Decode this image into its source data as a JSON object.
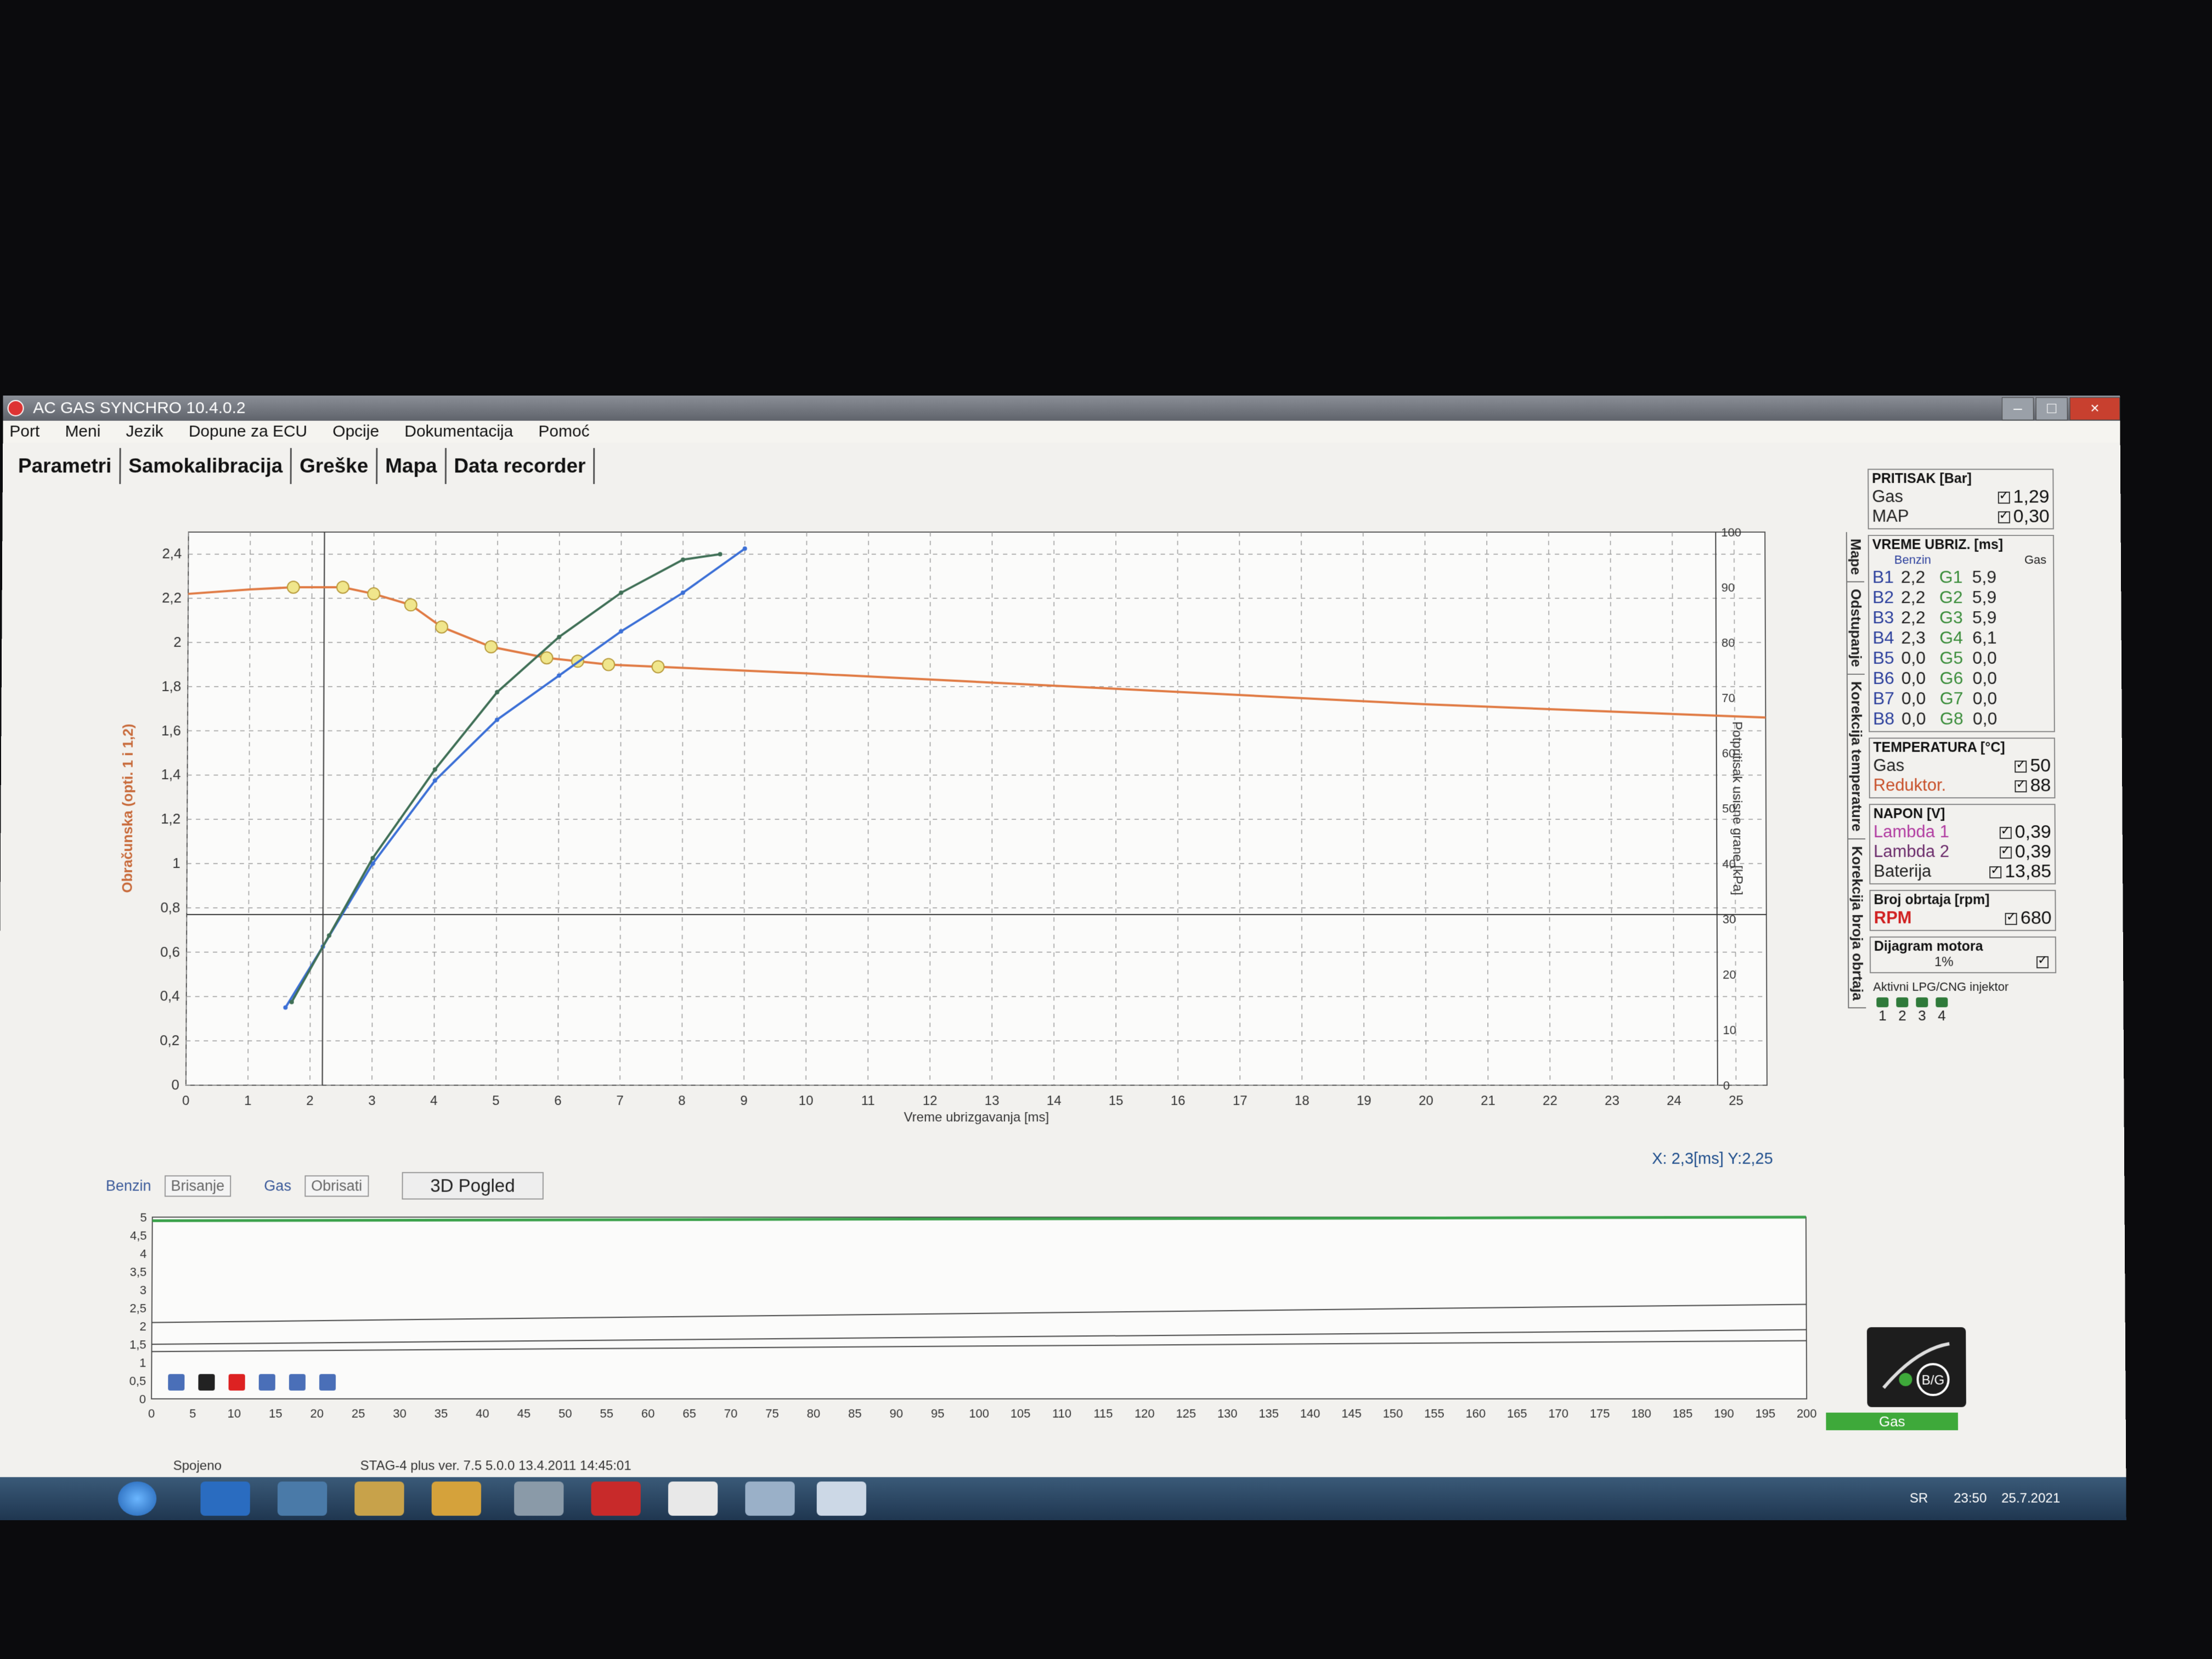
{
  "window": {
    "title": "AC GAS SYNCHRO  10.4.0.2",
    "controls": [
      "–",
      "□",
      "×"
    ]
  },
  "menu": [
    "Port",
    "Meni",
    "Jezik",
    "Dopune za ECU",
    "Opcije",
    "Dokumentacija",
    "Pomoć"
  ],
  "tabs": [
    "Parametri",
    "Samokalibracija",
    "Greške",
    "Mapa",
    "Data recorder"
  ],
  "cursor_readout": "X:  2,3[ms] Y:2,25",
  "bottom_toolbar": {
    "benzin_label": "Benzin",
    "brisanje": "Brisanje",
    "gas_label": "Gas",
    "obrisati": "Obrisati",
    "pogled": "3D Pogled"
  },
  "side_tabs": [
    "Mape",
    "Odstupanje",
    "Korekcija temperature",
    "Korekcija broja obrtaja"
  ],
  "pritisak": {
    "title": "PRITISAK [Bar]",
    "gas_label": "Gas",
    "gas_value": "1,29",
    "map_label": "MAP",
    "map_value": "0,30"
  },
  "vreme": {
    "title": "VREME UBRIZ. [ms]",
    "benzin_head": "Benzin",
    "gas_head": "Gas",
    "rows": [
      {
        "b": "B1",
        "bv": "2,2",
        "g": "G1",
        "gv": "5,9"
      },
      {
        "b": "B2",
        "bv": "2,2",
        "g": "G2",
        "gv": "5,9"
      },
      {
        "b": "B3",
        "bv": "2,2",
        "g": "G3",
        "gv": "5,9"
      },
      {
        "b": "B4",
        "bv": "2,3",
        "g": "G4",
        "gv": "6,1"
      },
      {
        "b": "B5",
        "bv": "0,0",
        "g": "G5",
        "gv": "0,0"
      },
      {
        "b": "B6",
        "bv": "0,0",
        "g": "G6",
        "gv": "0,0"
      },
      {
        "b": "B7",
        "bv": "0,0",
        "g": "G7",
        "gv": "0,0"
      },
      {
        "b": "B8",
        "bv": "0,0",
        "g": "G8",
        "gv": "0,0"
      }
    ]
  },
  "temperatura": {
    "title": "TEMPERATURA [°C]",
    "gas_label": "Gas",
    "gas_value": "50",
    "red_label": "Reduktor.",
    "red_value": "88"
  },
  "napon": {
    "title": "NAPON [V]",
    "l1_label": "Lambda 1",
    "l1_value": "0,39",
    "l2_label": "Lambda 2",
    "l2_value": "0,39",
    "bat_label": "Baterija",
    "bat_value": "13,85"
  },
  "obrtaji": {
    "title": "Broj obrtaja [rpm]",
    "rpm_label": "RPM",
    "rpm_value": "680"
  },
  "dijagram": {
    "title": "Dijagram motora",
    "value": "1%"
  },
  "injektori": {
    "title": "Aktivni LPG/CNG injektor",
    "numbers": [
      "1",
      "2",
      "3",
      "4"
    ]
  },
  "logo_label": "B/G",
  "gas_status": "Gas",
  "status": {
    "left": "Spojeno",
    "mid": "STAG-4 plus   ver. 7.5  5.0.0     13.4.2011 14:45:01"
  },
  "tray": {
    "lang": "SR",
    "time": "23:50",
    "date": "25.7.2021"
  },
  "colors": {
    "orange": "#e07a43",
    "blue": "#3b6fd6",
    "green": "#3f6f56",
    "yellow": "#f0e68c",
    "lowerGreen": "#3aa14a"
  },
  "chart_data": [
    {
      "type": "line",
      "xlabel": "Vreme ubrizgavanja [ms]",
      "ylabel": "Obračunska (opti. 1 i 1,2)",
      "y2label": "Potpritisak usisne grane [kPa]",
      "xlim": [
        0,
        25.5
      ],
      "ylim": [
        0,
        2.5
      ],
      "y2lim": [
        0,
        100
      ],
      "xticks": [
        0,
        1,
        2,
        3,
        4,
        5,
        6,
        7,
        8,
        9,
        10,
        11,
        12,
        13,
        14,
        15,
        16,
        17,
        18,
        19,
        20,
        21,
        22,
        23,
        24,
        25
      ],
      "yticks": [
        "0",
        "0,2",
        "0,4",
        "0,6",
        "0,8",
        "1",
        "1,2",
        "1,4",
        "1,6",
        "1,8",
        "2",
        "2,2",
        "2,4"
      ],
      "y2ticks": [
        0,
        10,
        20,
        30,
        40,
        50,
        60,
        70,
        80,
        90,
        100
      ],
      "cursor_x": 2.2,
      "hline_y": 0.77,
      "series": [
        {
          "color": "orange",
          "axis": "y",
          "x": [
            0,
            1,
            1.7,
            2.5,
            3,
            3.6,
            4.1,
            4.9,
            5.8,
            6.8,
            7.6,
            10,
            15,
            20,
            25.5
          ],
          "y": [
            2.22,
            2.24,
            2.25,
            2.25,
            2.22,
            2.17,
            2.07,
            1.98,
            1.93,
            1.9,
            1.89,
            1.86,
            1.79,
            1.72,
            1.66
          ],
          "markers_x": [
            1.7,
            2.5,
            3,
            3.6,
            4.1,
            4.9,
            5.8,
            6.3,
            6.8,
            7.6
          ]
        },
        {
          "color": "blue",
          "axis": "y2",
          "x": [
            1.6,
            2.2,
            3,
            4,
            5,
            6,
            7,
            8,
            9
          ],
          "y": [
            14,
            25,
            40,
            55,
            66,
            74,
            82,
            89,
            97
          ]
        },
        {
          "color": "green",
          "axis": "y2",
          "x": [
            1.7,
            2.3,
            3,
            4,
            5,
            6,
            7,
            8,
            8.6
          ],
          "y": [
            15,
            27,
            41,
            57,
            71,
            81,
            89,
            95,
            96
          ]
        }
      ]
    },
    {
      "type": "line",
      "xlim": [
        0,
        200
      ],
      "ylim": [
        0,
        5
      ],
      "xticks": [
        0,
        5,
        10,
        15,
        20,
        25,
        30,
        35,
        40,
        45,
        50,
        55,
        60,
        65,
        70,
        75,
        80,
        85,
        90,
        95,
        100,
        105,
        110,
        115,
        120,
        125,
        130,
        135,
        140,
        145,
        150,
        155,
        160,
        165,
        170,
        175,
        180,
        185,
        190,
        195,
        200
      ],
      "yticks": [
        "0",
        "0,5",
        "1",
        "1,5",
        "2",
        "2,5",
        "3",
        "3,5",
        "4",
        "4,5",
        "5"
      ],
      "series": [
        {
          "color": "lowerGreen",
          "y0": 4.9,
          "y1": 5.0
        },
        {
          "color": "#444",
          "y0": 2.1,
          "y1": 2.6
        },
        {
          "color": "#444",
          "y0": 1.5,
          "y1": 1.9
        },
        {
          "color": "#444",
          "y0": 1.3,
          "y1": 1.6
        }
      ]
    }
  ]
}
